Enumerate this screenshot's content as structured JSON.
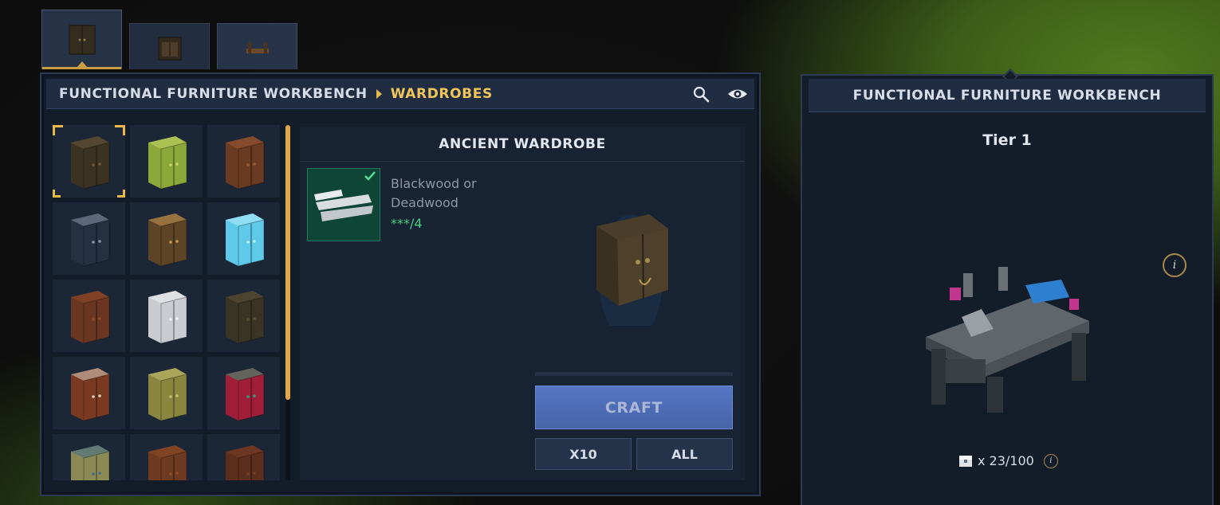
{
  "tabs": [
    {
      "name": "wardrobe-tab-icon",
      "active": true
    },
    {
      "name": "cabinet-tab-icon",
      "active": false
    },
    {
      "name": "bench-tab-icon",
      "active": false
    }
  ],
  "header": {
    "breadcrumb_root": "FUNCTIONAL FURNITURE WORKBENCH",
    "breadcrumb_current": "WARDROBES",
    "icons": [
      "search-icon",
      "eye-icon"
    ]
  },
  "items": [
    {
      "color": "#3b3222",
      "accent": "#6b5a3a"
    },
    {
      "color": "#8ca83a",
      "accent": "#c7d46a"
    },
    {
      "color": "#6a3a22",
      "accent": "#9a5a34"
    },
    {
      "color": "#253042",
      "accent": "#8a97a8"
    },
    {
      "color": "#5e4427",
      "accent": "#c49a52"
    },
    {
      "color": "#5fc9e9",
      "accent": "#b6efff"
    },
    {
      "color": "#6b3621",
      "accent": "#8f4a2a"
    },
    {
      "color": "#c9ccd0",
      "accent": "#f0f1f2"
    },
    {
      "color": "#3a3424",
      "accent": "#5c5238"
    },
    {
      "color": "#7a3a22",
      "accent": "#d8cfc2"
    },
    {
      "color": "#8a8640",
      "accent": "#c4c070"
    },
    {
      "color": "#a01e38",
      "accent": "#2e9c7a"
    },
    {
      "color": "#8b8a55",
      "accent": "#3f6f8a"
    },
    {
      "color": "#6e3a21",
      "accent": "#8f4d2a"
    },
    {
      "color": "#5b2e1d",
      "accent": "#7a3e26"
    }
  ],
  "detail": {
    "title": "ANCIENT WARDROBE",
    "material_name": "Blackwood or Deadwood",
    "material_count": "***/4",
    "craft_label": "CRAFT",
    "x10_label": "X10",
    "all_label": "ALL",
    "progress": 0.0
  },
  "side": {
    "title": "FUNCTIONAL FURNITURE WORKBENCH",
    "tier": "Tier 1",
    "info": "i",
    "storage": "x 23/100",
    "storage_info": "i"
  }
}
